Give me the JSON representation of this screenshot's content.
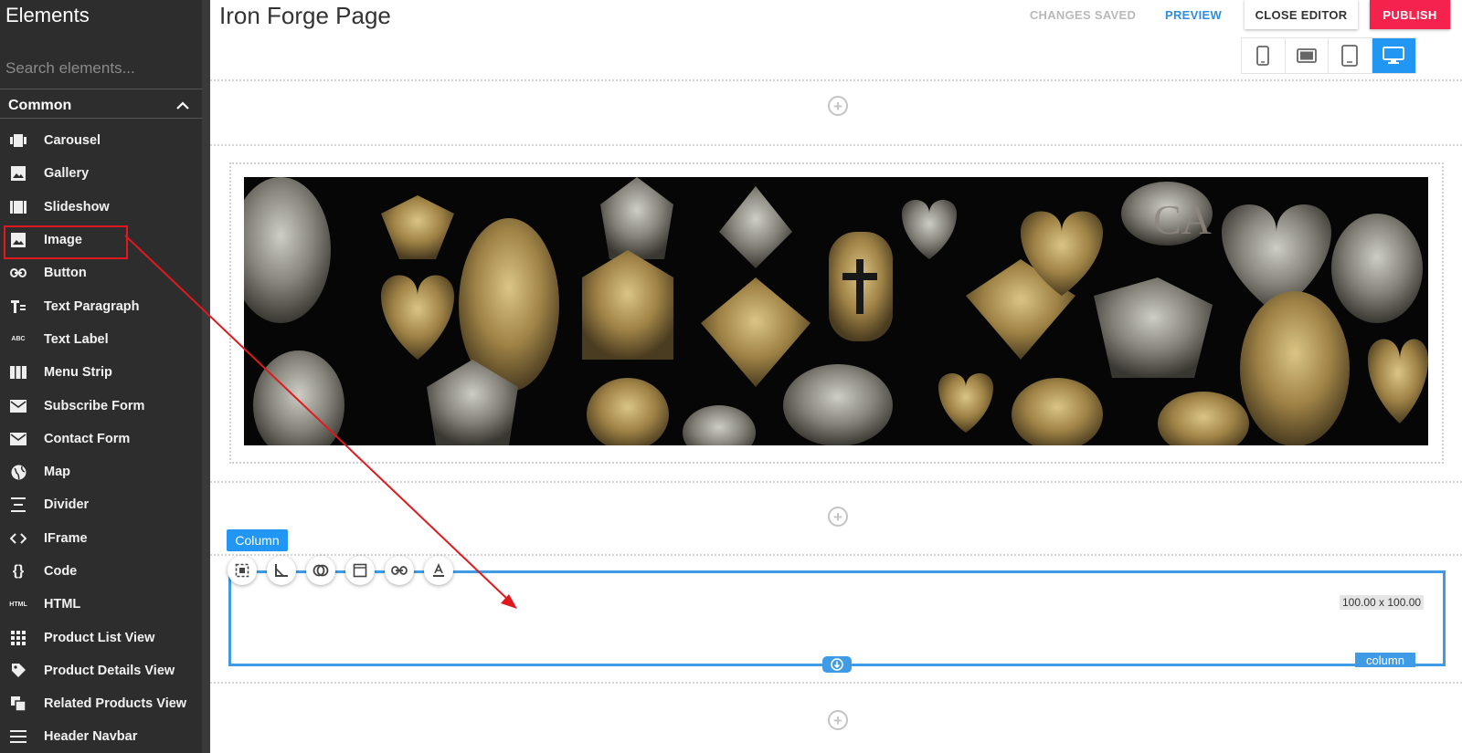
{
  "sidebar": {
    "title": "Elements",
    "search_placeholder": "Search elements...",
    "category": "Common",
    "items": [
      {
        "label": "Carousel",
        "icon": "carousel-icon"
      },
      {
        "label": "Gallery",
        "icon": "gallery-icon"
      },
      {
        "label": "Slideshow",
        "icon": "slideshow-icon"
      },
      {
        "label": "Image",
        "icon": "image-icon"
      },
      {
        "label": "Button",
        "icon": "link-icon"
      },
      {
        "label": "Text Paragraph",
        "icon": "text-paragraph-icon"
      },
      {
        "label": "Text Label",
        "icon": "abc-icon"
      },
      {
        "label": "Menu Strip",
        "icon": "menu-strip-icon"
      },
      {
        "label": "Subscribe Form",
        "icon": "mail-icon"
      },
      {
        "label": "Contact Form",
        "icon": "mail-icon"
      },
      {
        "label": "Map",
        "icon": "globe-icon"
      },
      {
        "label": "Divider",
        "icon": "divider-icon"
      },
      {
        "label": "IFrame",
        "icon": "code-brackets-icon"
      },
      {
        "label": "Code",
        "icon": "braces-icon"
      },
      {
        "label": "HTML",
        "icon": "html-icon"
      },
      {
        "label": "Product List View",
        "icon": "grid-icon"
      },
      {
        "label": "Product Details View",
        "icon": "tag-icon"
      },
      {
        "label": "Related Products View",
        "icon": "copy-icon"
      },
      {
        "label": "Header Navbar",
        "icon": "menu-icon"
      }
    ]
  },
  "header": {
    "page_title": "Iron Forge Page",
    "changes_saved": "CHANGES SAVED",
    "preview": "PREVIEW",
    "close_editor": "CLOSE EDITOR",
    "publish": "PUBLISH"
  },
  "devices": [
    "phone-icon",
    "tablet-landscape-icon",
    "tablet-icon",
    "desktop-icon"
  ],
  "canvas": {
    "column_tag": "Column",
    "column_size": "100.00 x 100.00",
    "column_label": "column",
    "banner_watermark": "CA",
    "toolbar": [
      "select-icon",
      "angle-icon",
      "layers-icon",
      "frame-icon",
      "link-icon",
      "text-color-icon"
    ]
  },
  "colors": {
    "accent": "#2196f3",
    "publish": "#f4224c",
    "sidebar_bg": "#2d2d2d",
    "annotation": "#e0191e"
  }
}
